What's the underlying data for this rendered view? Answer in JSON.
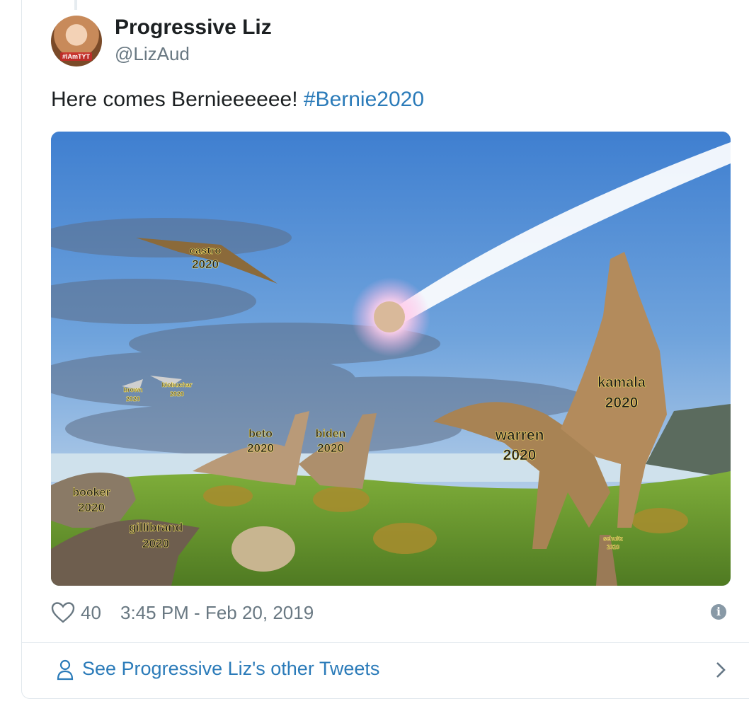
{
  "author": {
    "name": "Progressive Liz",
    "handle": "@LizAud",
    "avatar_tag": "#IAmTYT"
  },
  "tweet": {
    "text": "Here comes Bernieeeeee! ",
    "hashtag": "#Bernie2020"
  },
  "media": {
    "labels": {
      "castro": [
        "castro",
        "2020"
      ],
      "brown": [
        "brown",
        "2020"
      ],
      "klobuchar": [
        "klobuchar",
        "2020"
      ],
      "beto": [
        "beto",
        "2020"
      ],
      "biden": [
        "biden",
        "2020"
      ],
      "warren": [
        "warren",
        "2020"
      ],
      "kamala": [
        "kamala",
        "2020"
      ],
      "booker": [
        "booker",
        "2020"
      ],
      "gillibrand": [
        "gillibrand",
        "2020"
      ],
      "schultz": [
        "schultz",
        "2020"
      ]
    }
  },
  "footer": {
    "like_count": "40",
    "timestamp": "3:45 PM - Feb 20, 2019"
  },
  "other_link": {
    "text": "See Progressive Liz's other Tweets"
  },
  "icons": {
    "like": "heart-icon",
    "info": "info-icon",
    "person": "person-icon",
    "chevron": "chevron-right-icon"
  },
  "colors": {
    "link": "#2b7bb9",
    "meta": "#697882",
    "text": "#1c2022"
  }
}
